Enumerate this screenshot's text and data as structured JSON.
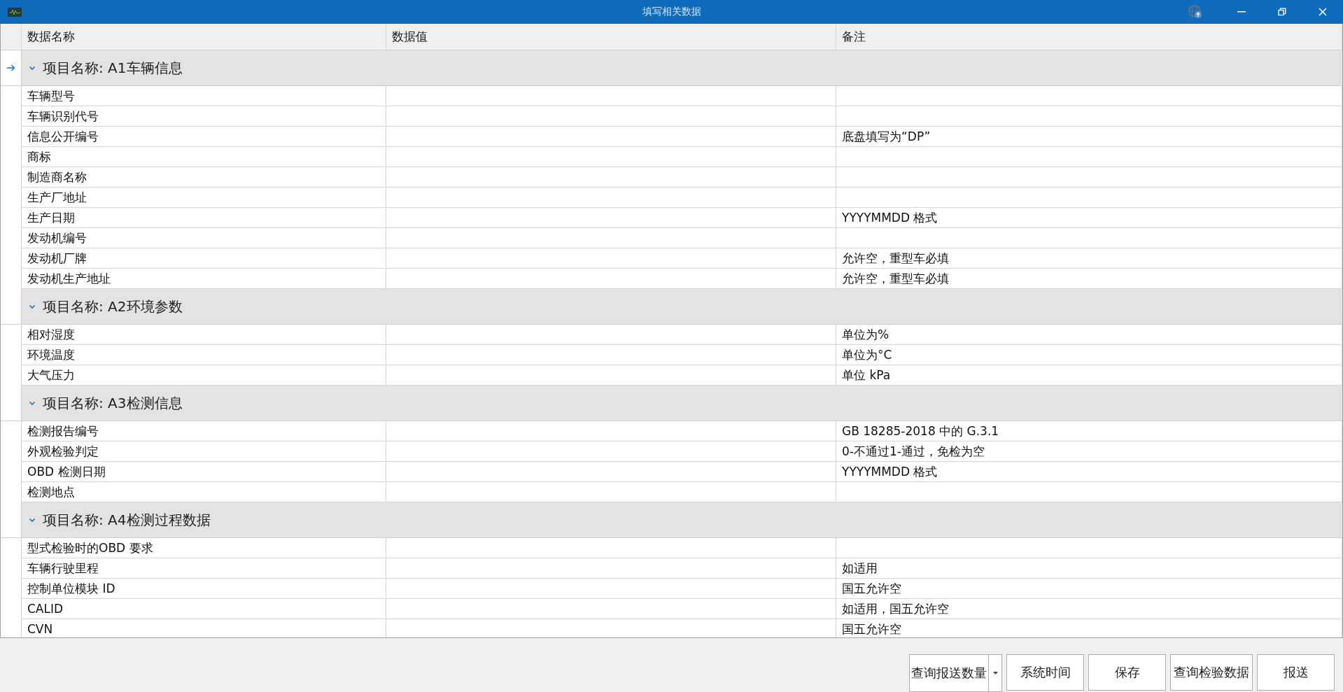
{
  "window": {
    "title": "填写相关数据"
  },
  "table": {
    "columns": [
      "数据名称",
      "数据值",
      "备注"
    ],
    "groups": [
      {
        "title": "项目名称: A1车辆信息",
        "expanded": true,
        "current": true,
        "rows": [
          {
            "name": "车辆型号"
          },
          {
            "name": "车辆识别代号"
          },
          {
            "name": "信息公开编号",
            "note": "底盘填写为“DP”"
          },
          {
            "name": "商标"
          },
          {
            "name": "制造商名称"
          },
          {
            "name": "生产厂地址"
          },
          {
            "name": "生产日期",
            "note": "YYYYMMDD 格式"
          },
          {
            "name": "发动机编号"
          },
          {
            "name": "发动机厂牌",
            "note": "允许空，重型车必填"
          },
          {
            "name": "发动机生产地址",
            "note": "允许空，重型车必填"
          }
        ]
      },
      {
        "title": "项目名称: A2环境参数",
        "expanded": true,
        "current": false,
        "rows": [
          {
            "name": "相对湿度",
            "note": "单位为%"
          },
          {
            "name": "环境温度",
            "note": "单位为°C"
          },
          {
            "name": "大气压力",
            "note": "单位 kPa"
          }
        ]
      },
      {
        "title": "项目名称: A3检测信息",
        "expanded": true,
        "current": false,
        "rows": [
          {
            "name": "检测报告编号",
            "note": "GB 18285-2018 中的 G.3.1"
          },
          {
            "name": "外观检验判定",
            "note": "0-不通过1-通过，免检为空"
          },
          {
            "name": "OBD 检测日期",
            "note": "YYYYMMDD 格式"
          },
          {
            "name": "检测地点"
          }
        ]
      },
      {
        "title": "项目名称: A4检测过程数据",
        "expanded": true,
        "current": false,
        "rows": [
          {
            "name": "型式检验时的OBD 要求"
          },
          {
            "name": "车辆行驶里程",
            "note": "如适用"
          },
          {
            "name": "控制单位模块 ID",
            "note": "国五允许空"
          },
          {
            "name": "CALID",
            "note": "如适用，国五允许空"
          },
          {
            "name": "CVN",
            "note": "国五允许空"
          }
        ]
      }
    ]
  },
  "buttons": [
    {
      "label": "查询报送数量",
      "kind": "split"
    },
    {
      "label": "系统时间",
      "kind": "plain"
    },
    {
      "label": "保存",
      "kind": "plain"
    },
    {
      "label": "查询检验数据",
      "kind": "plain"
    },
    {
      "label": "报送",
      "kind": "plain"
    }
  ]
}
